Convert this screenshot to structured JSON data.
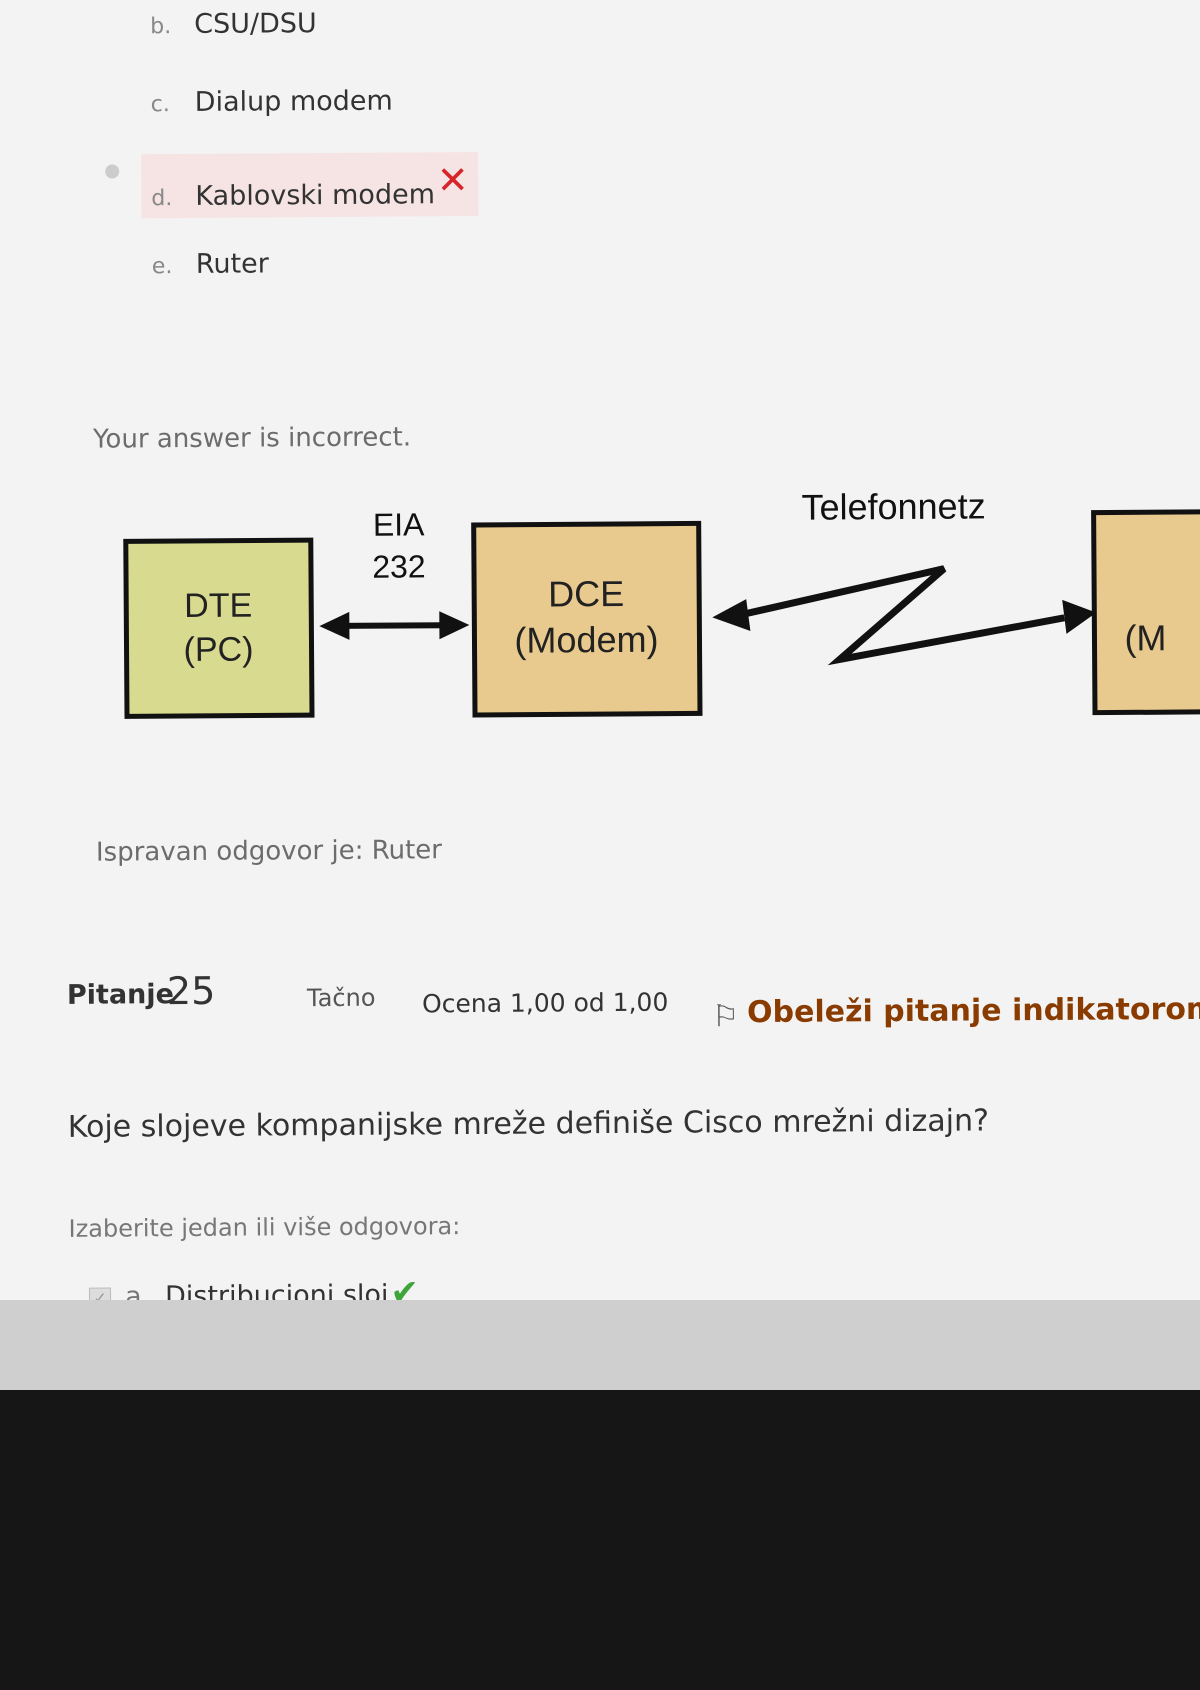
{
  "previous_question": {
    "answers": [
      {
        "letter": "b.",
        "text": "CSU/DSU"
      },
      {
        "letter": "c.",
        "text": "Dialup modem"
      },
      {
        "letter": "d.",
        "text": "Kablovski modem",
        "selected": true,
        "status": "incorrect"
      },
      {
        "letter": "e.",
        "text": "Ruter"
      }
    ],
    "feedback": "Your answer is incorrect.",
    "diagram": {
      "dte_line1": "DTE",
      "dte_line2": "(PC)",
      "interface_line1": "EIA",
      "interface_line2": "232",
      "dce_line1": "DCE",
      "dce_line2": "(Modem)",
      "network_label": "Telefonnetz",
      "right_box_partial": "(M"
    },
    "correct_answer": "Ispravan odgovor je: Ruter"
  },
  "question": {
    "label": "Pitanje",
    "number": "25",
    "state": "Tačno",
    "grade": "Ocena 1,00 od 1,00",
    "flag_label": "Obeleži pitanje indikatorom (",
    "text": "Koje slojeve kompanijske mreže definiše Cisco mrežni dizajn?",
    "prompt": "Izaberite jedan ili više odgovora:",
    "options": [
      {
        "letter": "a.",
        "text": "Distribucioni sloj",
        "checked": true,
        "status": "correct"
      }
    ]
  },
  "colors": {
    "incorrect_mark": "#d7262b",
    "correct_mark": "#3ea53a",
    "flag_text": "#8a3b00",
    "dte_box": "#d7da8f",
    "dce_box": "#e8c98e"
  },
  "icons": {
    "incorrect": "cross-icon",
    "correct": "check-icon",
    "flag": "flag-icon"
  }
}
